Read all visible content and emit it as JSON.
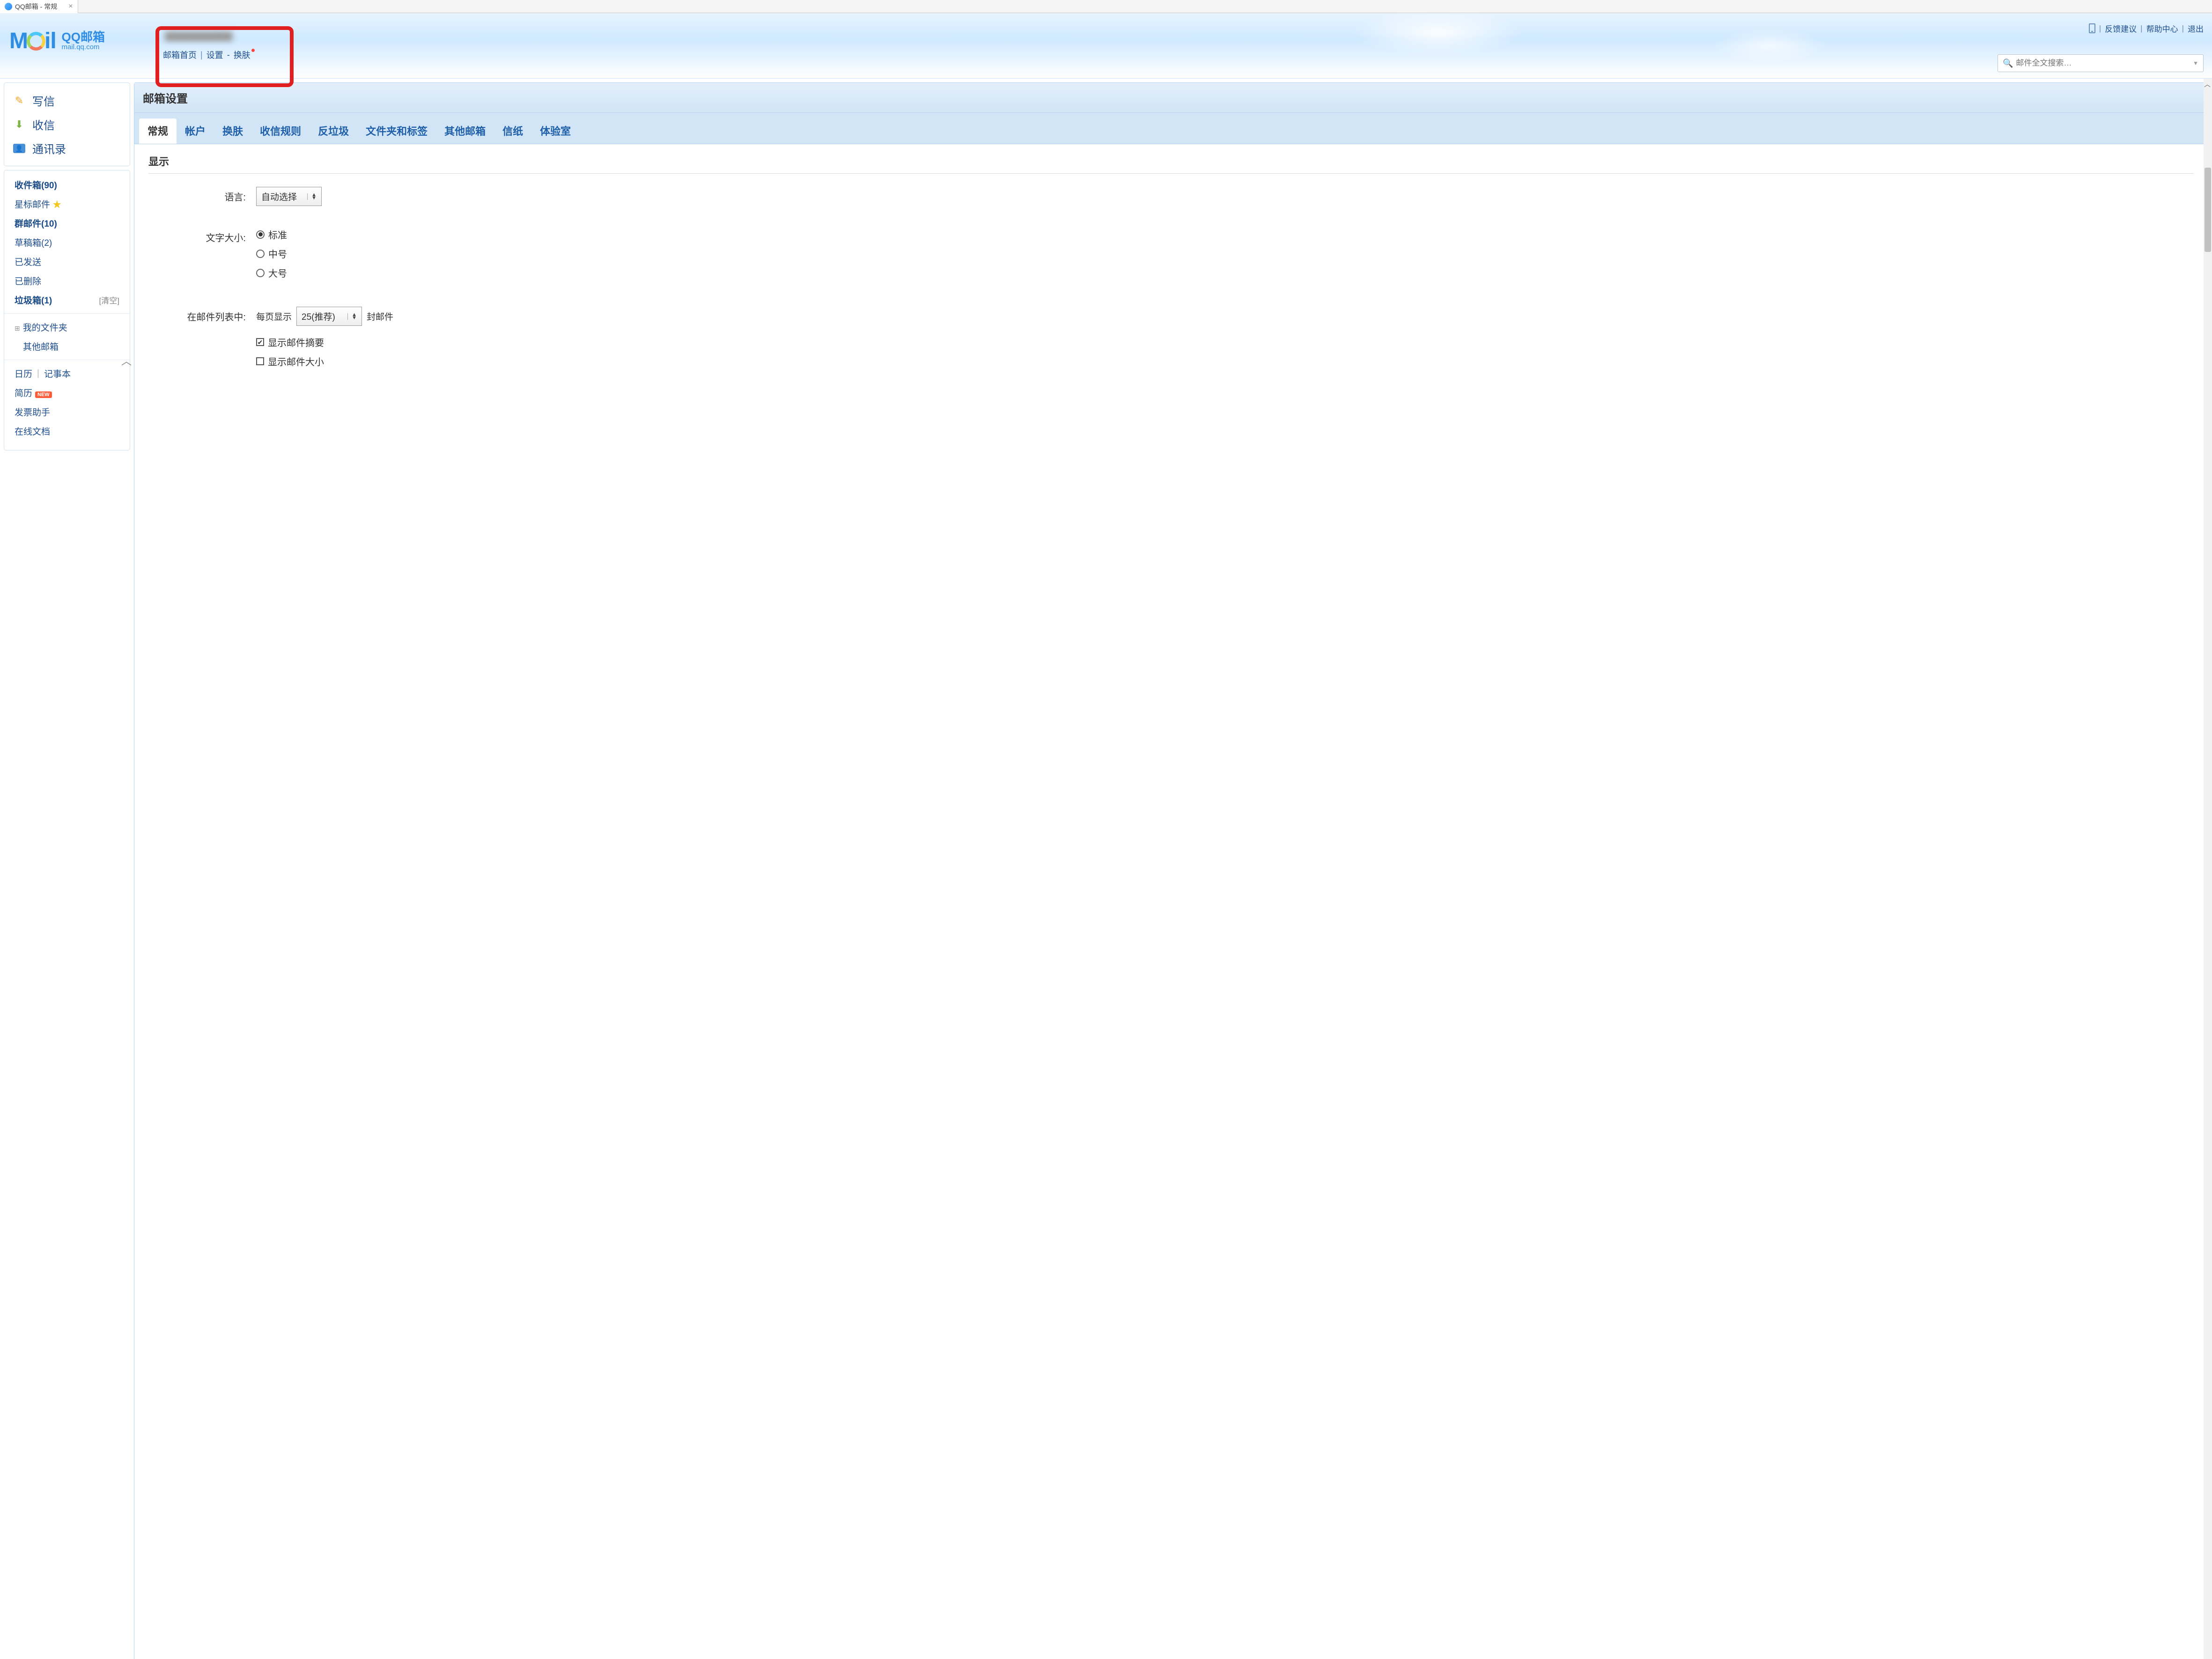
{
  "browser": {
    "tab_title": "QQ邮箱 - 常规"
  },
  "logo": {
    "text_main": "Mail",
    "text_cn": "QQ邮箱",
    "text_en": "mail.qq.com"
  },
  "top_links": {
    "feedback": "反馈建议",
    "help": "帮助中心",
    "logout": "退出"
  },
  "nav": {
    "home": "邮箱首页",
    "settings": "设置",
    "skin": "换肤"
  },
  "search": {
    "placeholder": "邮件全文搜索…"
  },
  "sidebar": {
    "compose": "写信",
    "receive": "收信",
    "contacts": "通讯录",
    "folders": {
      "inbox": "收件箱(90)",
      "starred": "星标邮件",
      "group": "群邮件(10)",
      "drafts": "草稿箱(2)",
      "sent": "已发送",
      "deleted": "已删除",
      "trash": "垃圾箱(1)",
      "trash_clear": "[清空]",
      "my_folders": "我的文件夹",
      "other_mail": "其他邮箱",
      "calendar": "日历",
      "notes": "记事本",
      "resume": "简历",
      "resume_badge": "NEW",
      "invoice": "发票助手",
      "online_docs": "在线文档"
    }
  },
  "settings": {
    "panel_title": "邮箱设置",
    "tabs": [
      "常规",
      "帐户",
      "换肤",
      "收信规则",
      "反垃圾",
      "文件夹和标签",
      "其他邮箱",
      "信纸",
      "体验室"
    ],
    "active_tab": "常规",
    "section_display": "显示",
    "language": {
      "label": "语言:",
      "value": "自动选择"
    },
    "font_size": {
      "label": "文字大小:",
      "options": [
        "标准",
        "中号",
        "大号"
      ],
      "selected": "标准"
    },
    "mail_list": {
      "label": "在邮件列表中:",
      "per_page_prefix": "每页显示",
      "per_page_value": "25(推荐)",
      "per_page_suffix": "封邮件",
      "show_summary": "显示邮件摘要",
      "show_summary_checked": true,
      "show_size": "显示邮件大小",
      "show_size_checked": false
    }
  }
}
